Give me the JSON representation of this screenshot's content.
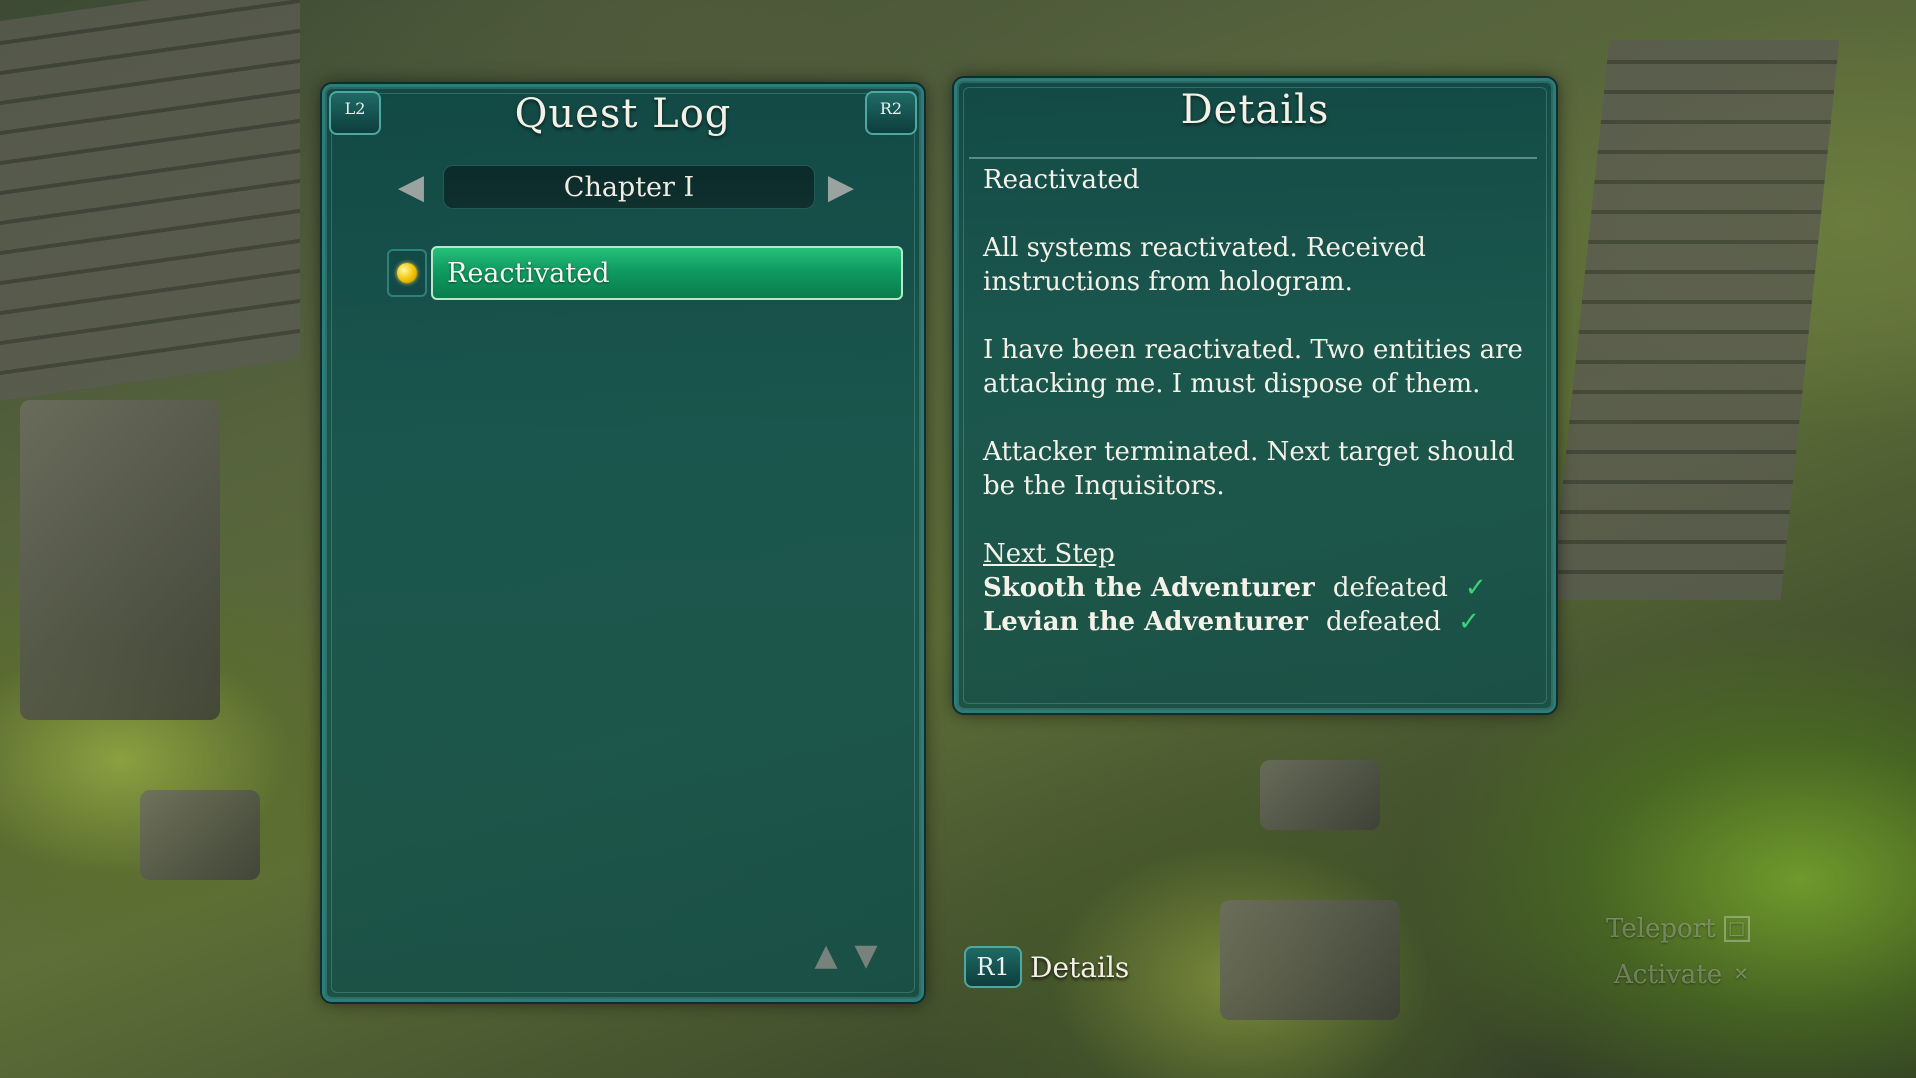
{
  "quest_log": {
    "title": "Quest Log",
    "left_shoulder": "L2",
    "right_shoulder": "R2",
    "chapter": "Chapter I",
    "prev_icon": "arrow-left-icon",
    "next_icon": "arrow-right-icon",
    "quests": [
      {
        "label": "Reactivated",
        "selected": true,
        "marker_color": "#f2c200"
      }
    ],
    "scroll_up_icon": "arrow-up-icon",
    "scroll_down_icon": "arrow-down-icon"
  },
  "details": {
    "title": "Details",
    "quest_name": "Reactivated",
    "paragraphs": [
      "All systems reactivated. Received instructions from hologram.",
      "I have been reactivated. Two entities are attacking me. I must dispose of them.",
      "Attacker terminated. Next target should be the Inquisitors."
    ],
    "next_step_title": "Next Step",
    "steps": [
      {
        "name": "Skooth the Adventurer",
        "status": "defeated",
        "check": "✓"
      },
      {
        "name": "Levian the Adventurer",
        "status": "defeated",
        "check": "✓"
      }
    ]
  },
  "hints": {
    "details_button": "R1",
    "details_label": "Details",
    "teleport_label": "Teleport",
    "teleport_glyph": "□",
    "activate_label": "Activate",
    "activate_glyph": "✕"
  },
  "colors": {
    "panel_bg": "#0e4846",
    "panel_border": "#2c7c7a",
    "selected_quest": "#0f9b62",
    "check_color": "#39d47a"
  }
}
